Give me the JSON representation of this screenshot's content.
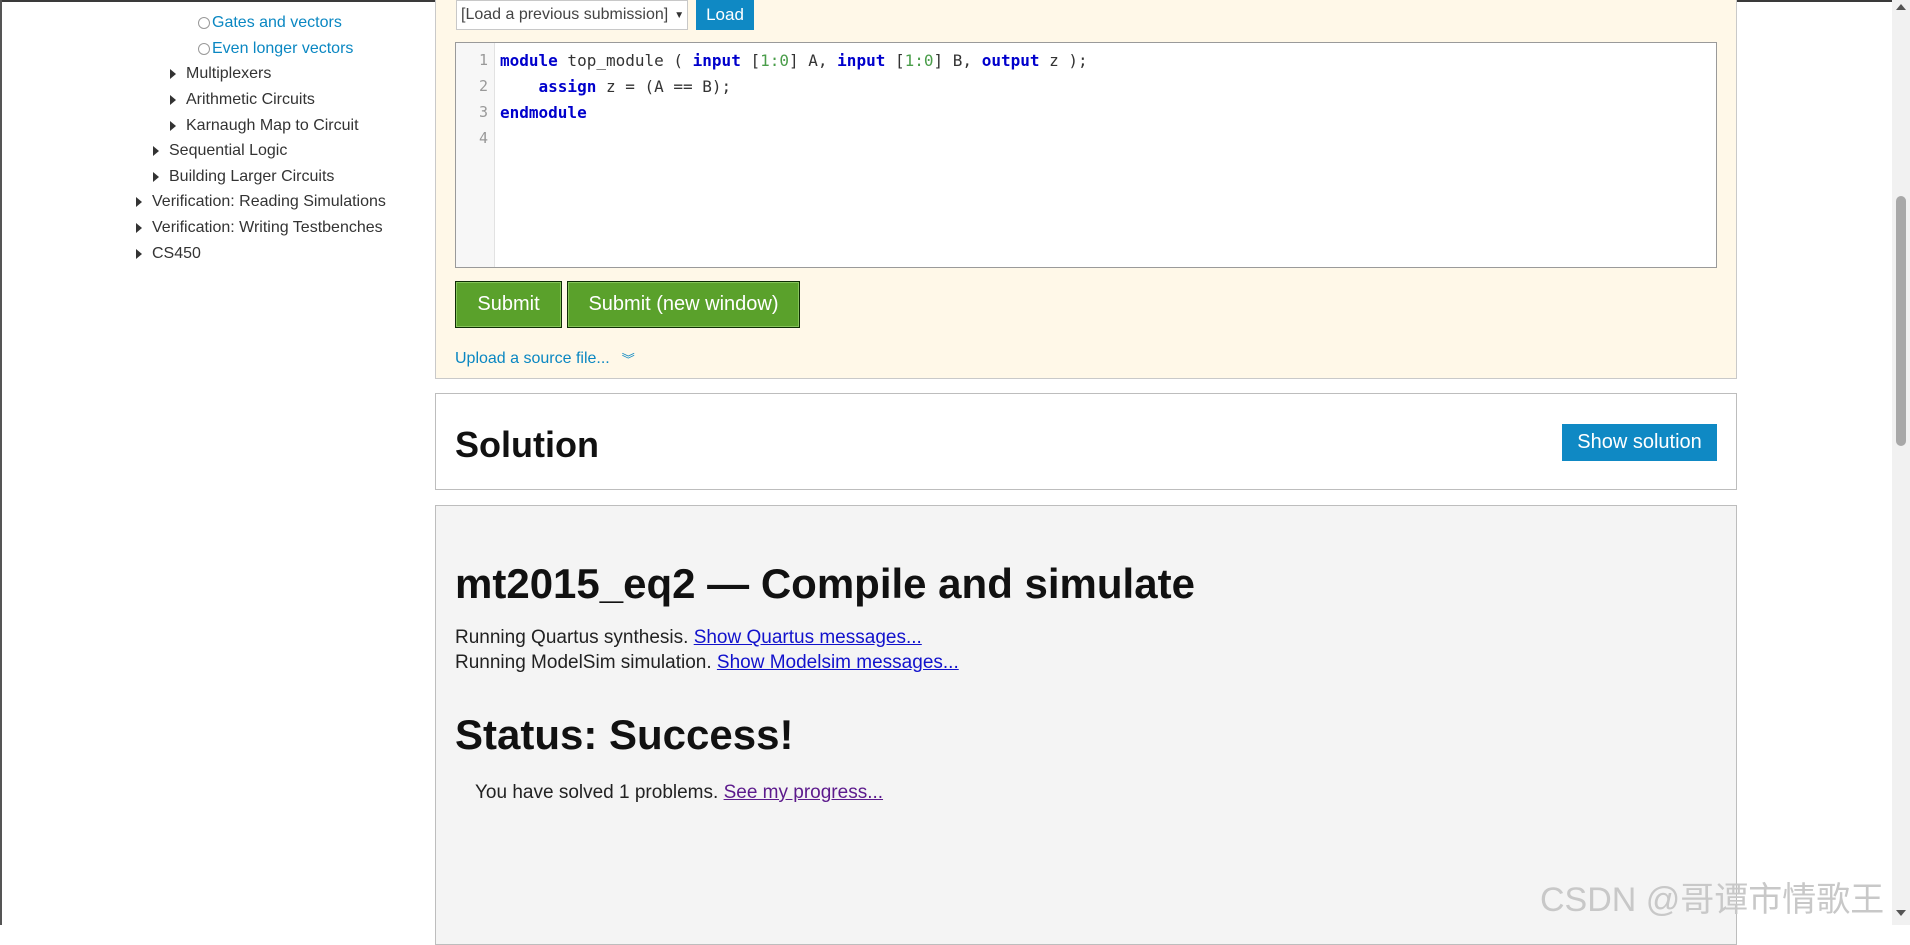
{
  "sidebar": {
    "items": [
      {
        "label": "Gates and vectors",
        "type": "circle",
        "link": true
      },
      {
        "label": "Even longer vectors",
        "type": "circle",
        "link": true
      },
      {
        "label": "Multiplexers",
        "type": "expand",
        "link": false
      },
      {
        "label": "Arithmetic Circuits",
        "type": "expand",
        "link": false
      },
      {
        "label": "Karnaugh Map to Circuit",
        "type": "expand",
        "link": false
      },
      {
        "label": "Sequential Logic",
        "type": "expand",
        "link": false
      },
      {
        "label": "Building Larger Circuits",
        "type": "expand",
        "link": false
      },
      {
        "label": "Verification: Reading Simulations",
        "type": "expand",
        "link": false
      },
      {
        "label": "Verification: Writing Testbenches",
        "type": "expand",
        "link": false
      },
      {
        "label": "CS450",
        "type": "expand",
        "link": false
      }
    ]
  },
  "submission": {
    "load_select_value": "[Load a previous submission]",
    "load_button": "Load",
    "submit_button": "Submit",
    "submit_new_window_button": "Submit (new window)",
    "upload_link": "Upload a source file..."
  },
  "editor": {
    "line_numbers": [
      "1",
      "2",
      "3",
      "4"
    ],
    "line1": {
      "kw1": "module",
      "t1": " top_module ( ",
      "kw2": "input",
      "t2": " [",
      "n1": "1:0",
      "t3": "] A, ",
      "kw3": "input",
      "t4": " [",
      "n2": "1:0",
      "t5": "] B, ",
      "kw4": "output",
      "t6": " z );"
    },
    "line2": {
      "indent": "    ",
      "kw": "assign",
      "t": " z = (A == B);"
    },
    "line3": {
      "kw": "endmodule"
    }
  },
  "solution": {
    "title": "Solution",
    "show_button": "Show solution"
  },
  "result": {
    "title": "mt2015_eq2 — Compile and simulate",
    "quartus_text": "Running Quartus synthesis. ",
    "quartus_link": "Show Quartus messages...",
    "modelsim_text": "Running ModelSim simulation. ",
    "modelsim_link": "Show Modelsim messages...",
    "status": "Status: Success!",
    "progress_text": "You have solved 1 problems. ",
    "progress_link": "See my progress..."
  },
  "watermark": "CSDN @哥谭市情歌王",
  "colors": {
    "accent_blue": "#0f89c4",
    "submit_green": "#5aa12b",
    "panel_bg": "#fff8e8"
  }
}
